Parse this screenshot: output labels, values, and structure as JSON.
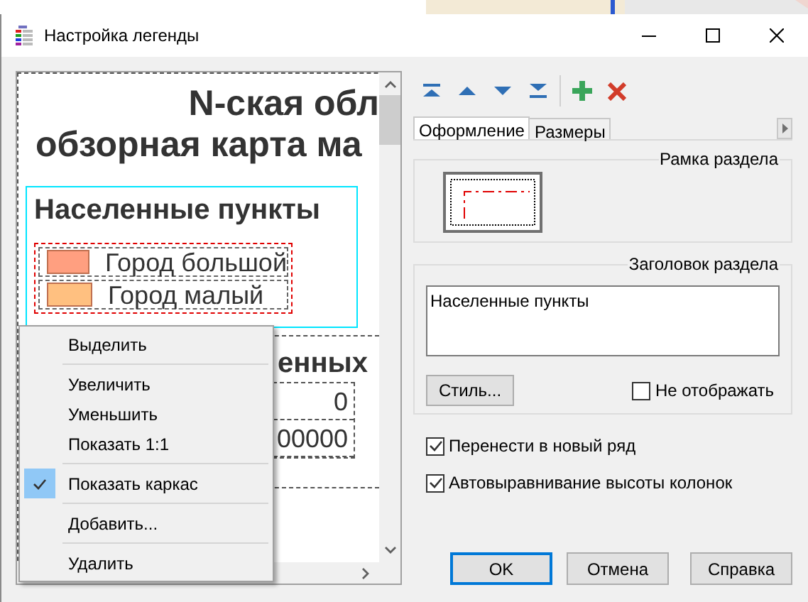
{
  "window": {
    "title": "Настройка легенды"
  },
  "preview": {
    "title_lines": [
      "N-ская обл",
      "обзорная карта ма"
    ],
    "sections": [
      {
        "title": "Населенные пункты",
        "selected": true,
        "items": [
          {
            "label": "Город большой",
            "color": "#ff9f80"
          },
          {
            "label": "Город малый",
            "color": "#ffc080"
          }
        ]
      },
      {
        "title": "енных",
        "selected": false,
        "items": [
          {
            "label": "0"
          },
          {
            "label": "00000"
          }
        ]
      }
    ]
  },
  "context_menu": {
    "items": [
      {
        "kind": "item",
        "label": "Выделить",
        "checked": false
      },
      {
        "kind": "separator"
      },
      {
        "kind": "item",
        "label": "Увеличить",
        "checked": false
      },
      {
        "kind": "item",
        "label": "Уменьшить",
        "checked": false
      },
      {
        "kind": "item",
        "label": "Показать 1:1",
        "checked": false
      },
      {
        "kind": "separator"
      },
      {
        "kind": "item",
        "label": "Показать каркас",
        "checked": true
      },
      {
        "kind": "separator"
      },
      {
        "kind": "item",
        "label": "Добавить...",
        "checked": false
      },
      {
        "kind": "separator"
      },
      {
        "kind": "item",
        "label": "Удалить",
        "checked": false
      }
    ]
  },
  "tabs": [
    {
      "label": "Оформление",
      "selected": true
    },
    {
      "label": "Размеры",
      "selected": false
    }
  ],
  "frame_group": {
    "label": "Рамка раздела"
  },
  "header_group": {
    "label": "Заголовок раздела",
    "text": "Населенные пункты",
    "style_button": "Стиль...",
    "hide": {
      "label": "Не отображать",
      "checked": false
    }
  },
  "options": [
    {
      "label": "Перенести в новый ряд",
      "checked": true
    },
    {
      "label": "Автовыравнивание высоты колонок",
      "checked": true
    }
  ],
  "buttons": [
    {
      "label": "OK",
      "default": true
    },
    {
      "label": "Отмена",
      "default": false
    },
    {
      "label": "Справка",
      "default": false
    }
  ]
}
